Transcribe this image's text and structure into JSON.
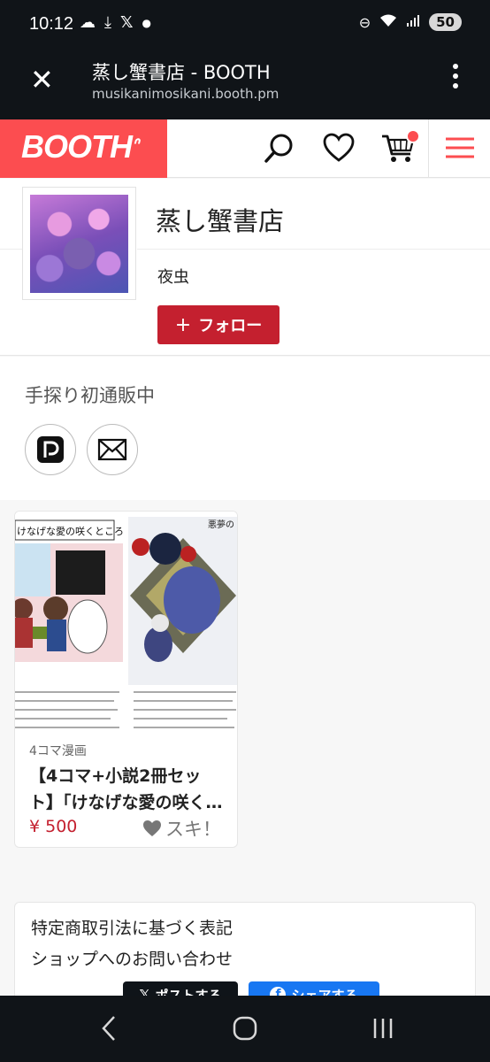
{
  "status_bar": {
    "time": "10:12",
    "battery": "50"
  },
  "custom_tab": {
    "title": "蒸し蟹書店 - BOOTH",
    "url": "musikanimosikani.booth.pm"
  },
  "header": {
    "logo": "BOOTH"
  },
  "shop": {
    "name": "蒸し蟹書店",
    "owner": "夜虫",
    "follow_label": "フォロー",
    "tagline": "手探り初通販中"
  },
  "items": [
    {
      "category": "4コマ漫画",
      "title_line1": "【4コマ+小説2冊セッ",
      "title_line2": "ト】「けなげな愛の咲く…",
      "price": "¥ 500",
      "like_label": "スキ！",
      "image_caption": "けなげな愛の咲くところ",
      "image_caption2": "悪夢の"
    }
  ],
  "footer": {
    "legal": "特定商取引法に基づく表記",
    "contact": "ショップへのお問い合わせ",
    "share_x": "ポストする",
    "share_fb": "シェアする"
  },
  "colors": {
    "brand": "#fc4d50",
    "follow": "#c4202f",
    "price": "#c4202f"
  }
}
